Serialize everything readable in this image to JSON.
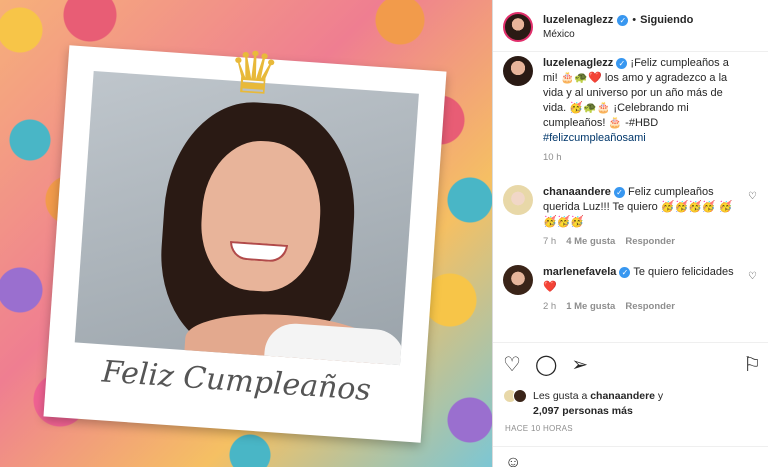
{
  "image": {
    "caption": "Feliz Cumpleaños"
  },
  "header": {
    "username": "luzelenaglezz",
    "separator": "•",
    "follow_status": "Siguiendo",
    "location": "México"
  },
  "post": {
    "username": "luzelenaglezz",
    "text": "¡Feliz cumpleaños a mi! 🎂🐢❤️ los amo y agradezco a la vida y al universo por un año más de vida. 🥳🐢🎂 ¡Celebrando mi cumpleaños! 🎂 -#HBD",
    "hashtag": "#felizcumpleañosami",
    "time": "10 h"
  },
  "comments": [
    {
      "username": "chanaandere",
      "text": "Feliz cumpleaños querida Luz!!! Te quiero 🥳🥳🥳🥳 🥳🥳🥳🥳",
      "time": "7 h",
      "likes": "4 Me gusta",
      "reply": "Responder"
    },
    {
      "username": "marlenefavela",
      "text": "Te quiero felicidades ❤️",
      "time": "2 h",
      "likes": "1 Me gusta",
      "reply": "Responder"
    }
  ],
  "likes": {
    "prefix": "Les gusta a",
    "user": "chanaandere",
    "conjunction": "y",
    "count": "2,097 personas más"
  },
  "timestamp": "HACE 10 HORAS",
  "colors": {
    "verified": "#3897f0",
    "heart": "#ed4956",
    "story_ring": "#e1306c"
  }
}
